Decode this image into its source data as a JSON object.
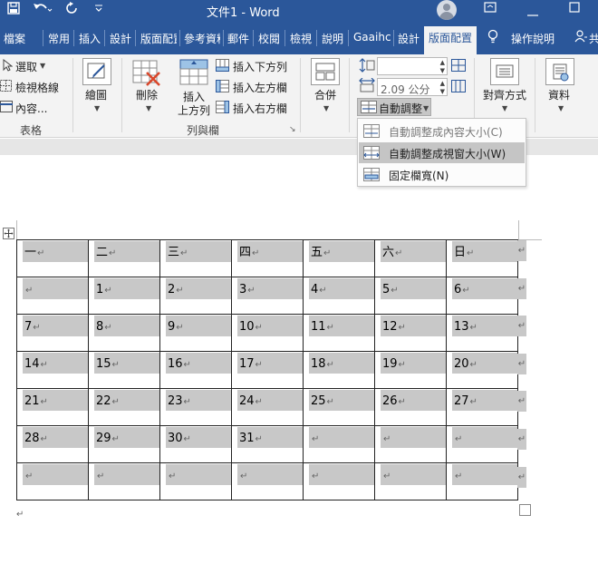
{
  "titlebar": {
    "doc_title": "文件1 - Word",
    "save_icon": "save-icon",
    "undo_icon": "undo-icon",
    "redo_icon": "redo-icon",
    "customize_icon": "customize-qat-icon",
    "min_glyph": "⊟",
    "close_glyph": "☐"
  },
  "tabs": [
    {
      "label": "檔案"
    },
    {
      "label": "常用"
    },
    {
      "label": "插入"
    },
    {
      "label": "設計"
    },
    {
      "label": "版面配置"
    },
    {
      "label": "參考資料"
    },
    {
      "label": "郵件"
    },
    {
      "label": "校閱"
    },
    {
      "label": "檢視"
    },
    {
      "label": "說明"
    },
    {
      "label": "Gaaihc"
    },
    {
      "label": "設計"
    }
  ],
  "active_tab": {
    "label": "版面配置"
  },
  "tell_me": {
    "label": "操作說明"
  },
  "share": {
    "label": "共"
  },
  "ribbon": {
    "table_group": {
      "label": "表格",
      "select_label": "選取",
      "gridlines_label": "檢視格線",
      "properties_label": "內容..."
    },
    "draw_group": {
      "label": "繪圖"
    },
    "rows_cols_group": {
      "label": "列與欄",
      "delete_label": "刪除",
      "insert_above_label_1": "插入",
      "insert_above_label_2": "上方列",
      "insert_below_label": "插入下方列",
      "insert_left_label": "插入左方欄",
      "insert_right_label": "插入右方欄"
    },
    "merge_group": {
      "label": "合併"
    },
    "cell_size_group": {
      "height_value": "",
      "width_value": "2.09 公分",
      "autofit_label": "自動調整"
    },
    "alignment_group": {
      "label": "對齊方式"
    },
    "data_group": {
      "label": "資料"
    }
  },
  "dropdown": {
    "items": [
      {
        "label": "自動調整成內容大小(C)",
        "state": "disabled"
      },
      {
        "label": "自動調整成視窗大小(W)",
        "state": "hover"
      },
      {
        "label": "固定欄寬(N)",
        "state": "normal"
      }
    ]
  },
  "table": {
    "mark": "↵",
    "rows": [
      [
        "一",
        "二",
        "三",
        "四",
        "五",
        "六",
        "日"
      ],
      [
        "",
        "1",
        "2",
        "3",
        "4",
        "5",
        "6"
      ],
      [
        "7",
        "8",
        "9",
        "10",
        "11",
        "12",
        "13"
      ],
      [
        "14",
        "15",
        "16",
        "17",
        "18",
        "19",
        "20"
      ],
      [
        "21",
        "22",
        "23",
        "24",
        "25",
        "26",
        "27"
      ],
      [
        "28",
        "29",
        "30",
        "31",
        "",
        "",
        ""
      ],
      [
        "",
        "",
        "",
        "",
        "",
        "",
        ""
      ]
    ]
  },
  "colors": {
    "brand": "#2b579a",
    "ribbon_bg": "#f3f3f3",
    "cell_shading": "#c8c8c8"
  }
}
